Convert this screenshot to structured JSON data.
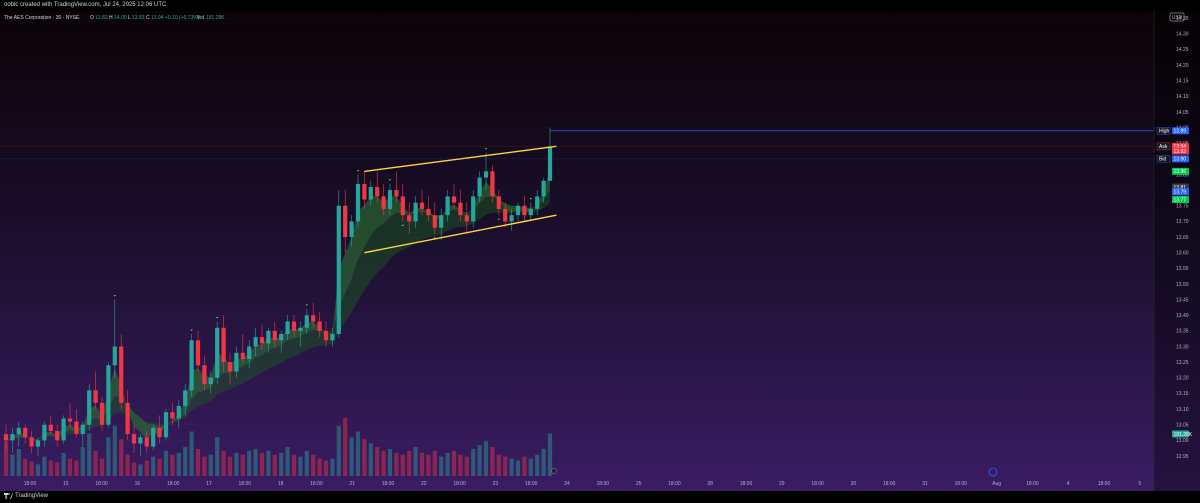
{
  "top_caption": "oobic created with TradingView.com, Jul 24, 2025 12:06 UTC",
  "legend": {
    "name": "The AES Corporation · 30 · NYSE",
    "o_label": "O",
    "o_value": "13.83",
    "h_label": "H",
    "h_value": "14.00",
    "l_label": "L",
    "l_value": "13.83",
    "c_label": "C",
    "c_value": "13.94",
    "change": "+0.10 (+0.73%)",
    "vol_label": "Vol",
    "vol_value": "181.28K"
  },
  "price_axis": {
    "currency": "USD",
    "ticks": [
      14.35,
      14.3,
      14.25,
      14.2,
      14.15,
      14.1,
      14.05,
      14.0,
      13.95,
      13.9,
      13.85,
      13.8,
      13.75,
      13.7,
      13.65,
      13.6,
      13.55,
      13.5,
      13.45,
      13.4,
      13.35,
      13.3,
      13.25,
      13.2,
      13.15,
      13.1,
      13.05,
      13.0,
      12.95
    ],
    "tags": [
      {
        "label": "High",
        "value": "13.99",
        "color": "#2962ff"
      },
      {
        "label": "Ask",
        "value": "13.94",
        "color": "#f23645"
      },
      {
        "label": "",
        "value": "13.93",
        "color": "#f23645"
      },
      {
        "label": "Bid",
        "value": "13.90",
        "color": "#2962ff"
      },
      {
        "label": "",
        "value": "13.86",
        "color": "#00c853"
      },
      {
        "label": "",
        "value": "13.81",
        "color": "#363a45"
      },
      {
        "label": "",
        "value": "13.79",
        "color": "#2962ff"
      },
      {
        "label": "",
        "value": "13.77",
        "color": "#00c853"
      },
      {
        "label": "",
        "value": "181.28K",
        "color": "#26a69a"
      }
    ]
  },
  "time_axis": {
    "labels": [
      "18:00",
      "15",
      "18:00",
      "16",
      "18:00",
      "17",
      "18:00",
      "18",
      "18:00",
      "21",
      "18:00",
      "22",
      "18:00",
      "23",
      "18:00",
      "24",
      "18:00",
      "25",
      "18:00",
      "28",
      "18:00",
      "29",
      "18:00",
      "30",
      "18:00",
      "31",
      "18:00",
      "Aug",
      "18:00",
      "4",
      "18:00",
      "5"
    ]
  },
  "chart_data": {
    "type": "candlestick",
    "ylim": [
      12.95,
      14.36
    ],
    "high_line": 13.99,
    "candles": [
      [
        13.02,
        13.05,
        12.97,
        13.0
      ],
      [
        13.0,
        13.04,
        12.96,
        13.02
      ],
      [
        13.02,
        13.06,
        12.98,
        13.04
      ],
      [
        13.04,
        13.05,
        12.99,
        13.01
      ],
      [
        13.01,
        13.03,
        12.96,
        12.98
      ],
      [
        12.98,
        13.01,
        12.95,
        13.0
      ],
      [
        13.0,
        13.06,
        12.98,
        13.05
      ],
      [
        13.05,
        13.08,
        13.02,
        13.03
      ],
      [
        13.03,
        13.05,
        12.98,
        13.0
      ],
      [
        13.0,
        13.08,
        12.99,
        13.07
      ],
      [
        13.07,
        13.12,
        13.04,
        13.06
      ],
      [
        13.06,
        13.1,
        13.01,
        13.02
      ],
      [
        13.02,
        13.06,
        12.98,
        13.05
      ],
      [
        13.05,
        13.18,
        13.03,
        13.16
      ],
      [
        13.16,
        13.22,
        13.1,
        13.12
      ],
      [
        13.12,
        13.14,
        13.03,
        13.05
      ],
      [
        13.05,
        13.25,
        13.04,
        13.24
      ],
      [
        13.24,
        13.45,
        13.2,
        13.3
      ],
      [
        13.3,
        13.34,
        13.1,
        13.12
      ],
      [
        13.12,
        13.16,
        13.0,
        13.02
      ],
      [
        13.02,
        13.05,
        12.96,
        12.99
      ],
      [
        12.99,
        13.02,
        12.95,
        13.01
      ],
      [
        13.01,
        13.03,
        12.96,
        12.98
      ],
      [
        12.98,
        13.05,
        12.97,
        13.04
      ],
      [
        13.04,
        13.08,
        12.99,
        13.01
      ],
      [
        13.01,
        13.1,
        13.0,
        13.09
      ],
      [
        13.09,
        13.12,
        13.05,
        13.07
      ],
      [
        13.07,
        13.13,
        13.04,
        13.11
      ],
      [
        13.11,
        13.18,
        13.08,
        13.16
      ],
      [
        13.16,
        13.34,
        13.14,
        13.32
      ],
      [
        13.32,
        13.35,
        13.22,
        13.24
      ],
      [
        13.24,
        13.27,
        13.16,
        13.18
      ],
      [
        13.18,
        13.22,
        13.15,
        13.2
      ],
      [
        13.2,
        13.38,
        13.18,
        13.36
      ],
      [
        13.36,
        13.4,
        13.22,
        13.25
      ],
      [
        13.25,
        13.28,
        13.18,
        13.22
      ],
      [
        13.22,
        13.3,
        13.2,
        13.28
      ],
      [
        13.28,
        13.34,
        13.25,
        13.26
      ],
      [
        13.26,
        13.32,
        13.23,
        13.3
      ],
      [
        13.3,
        13.36,
        13.27,
        13.33
      ],
      [
        13.33,
        13.37,
        13.29,
        13.31
      ],
      [
        13.31,
        13.36,
        13.28,
        13.35
      ],
      [
        13.35,
        13.38,
        13.3,
        13.32
      ],
      [
        13.32,
        13.35,
        13.28,
        13.34
      ],
      [
        13.34,
        13.4,
        13.32,
        13.38
      ],
      [
        13.38,
        13.4,
        13.33,
        13.35
      ],
      [
        13.35,
        13.38,
        13.3,
        13.36
      ],
      [
        13.36,
        13.42,
        13.34,
        13.4
      ],
      [
        13.4,
        13.44,
        13.36,
        13.38
      ],
      [
        13.38,
        13.41,
        13.33,
        13.35
      ],
      [
        13.35,
        13.38,
        13.3,
        13.32
      ],
      [
        13.32,
        13.36,
        13.3,
        13.34
      ],
      [
        13.34,
        13.8,
        13.33,
        13.75
      ],
      [
        13.75,
        13.8,
        13.6,
        13.65
      ],
      [
        13.65,
        13.72,
        13.62,
        13.7
      ],
      [
        13.7,
        13.85,
        13.68,
        13.82
      ],
      [
        13.82,
        13.86,
        13.74,
        13.77
      ],
      [
        13.77,
        13.83,
        13.75,
        13.81
      ],
      [
        13.81,
        13.86,
        13.76,
        13.78
      ],
      [
        13.78,
        13.82,
        13.72,
        13.74
      ],
      [
        13.74,
        13.82,
        13.72,
        13.8
      ],
      [
        13.8,
        13.86,
        13.76,
        13.78
      ],
      [
        13.78,
        13.82,
        13.7,
        13.72
      ],
      [
        13.72,
        13.76,
        13.66,
        13.7
      ],
      [
        13.7,
        13.78,
        13.68,
        13.76
      ],
      [
        13.76,
        13.8,
        13.72,
        13.74
      ],
      [
        13.74,
        13.78,
        13.7,
        13.72
      ],
      [
        13.72,
        13.76,
        13.66,
        13.68
      ],
      [
        13.68,
        13.74,
        13.64,
        13.72
      ],
      [
        13.72,
        13.8,
        13.7,
        13.78
      ],
      [
        13.78,
        13.82,
        13.74,
        13.76
      ],
      [
        13.76,
        13.8,
        13.7,
        13.72
      ],
      [
        13.72,
        13.76,
        13.66,
        13.7
      ],
      [
        13.7,
        13.8,
        13.68,
        13.78
      ],
      [
        13.78,
        13.86,
        13.76,
        13.84
      ],
      [
        13.84,
        13.92,
        13.8,
        13.86
      ],
      [
        13.86,
        13.88,
        13.76,
        13.78
      ],
      [
        13.78,
        13.8,
        13.72,
        13.74
      ],
      [
        13.74,
        13.76,
        13.68,
        13.7
      ],
      [
        13.7,
        13.74,
        13.67,
        13.72
      ],
      [
        13.72,
        13.76,
        13.7,
        13.75
      ],
      [
        13.75,
        13.78,
        13.7,
        13.72
      ],
      [
        13.72,
        13.76,
        13.7,
        13.74
      ],
      [
        13.74,
        13.8,
        13.72,
        13.78
      ],
      [
        13.78,
        13.84,
        13.76,
        13.83
      ],
      [
        13.83,
        14.0,
        13.83,
        13.94
      ]
    ],
    "volumes": [
      36,
      22,
      28,
      18,
      15,
      12,
      20,
      16,
      14,
      24,
      18,
      16,
      30,
      44,
      26,
      18,
      40,
      52,
      38,
      22,
      14,
      12,
      16,
      20,
      18,
      26,
      22,
      24,
      30,
      46,
      28,
      20,
      22,
      40,
      26,
      20,
      24,
      22,
      26,
      28,
      24,
      26,
      22,
      24,
      30,
      22,
      20,
      26,
      22,
      18,
      16,
      18,
      52,
      60,
      40,
      46,
      38,
      34,
      30,
      26,
      28,
      24,
      22,
      26,
      30,
      24,
      22,
      26,
      20,
      24,
      26,
      22,
      20,
      28,
      32,
      36,
      30,
      22,
      20,
      18,
      16,
      20,
      18,
      22,
      28,
      44
    ],
    "channel": {
      "upper": [
        [
          56,
          13.86
        ],
        [
          86,
          13.94
        ]
      ],
      "lower": [
        [
          56,
          13.6
        ],
        [
          86,
          13.72
        ]
      ]
    }
  },
  "colors": {
    "bull": "#26a69a",
    "bear": "#f23645",
    "channel": "#ffd740",
    "high_line": "#2962ff",
    "cloud_green": "#1b5e20"
  },
  "footer": {
    "brand": "TradingView"
  }
}
